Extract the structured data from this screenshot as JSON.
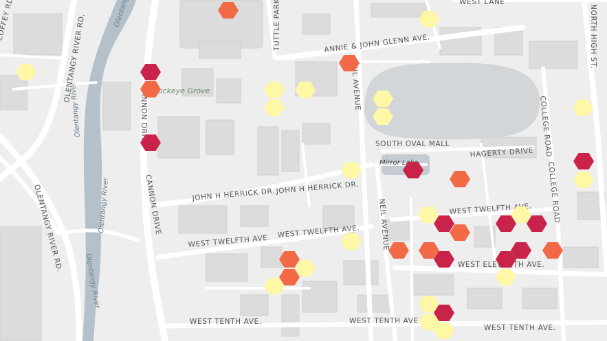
{
  "map": {
    "colors": {
      "low": "#fdf7a6",
      "medium": "#f26a45",
      "high": "#c9234a",
      "background": "#eeeeee",
      "road": "#ffffff",
      "building": "#dcdcdc",
      "water": "#b4c1cb",
      "oval": "#d3d6d8"
    },
    "labels": {
      "tuttle_park": "TUTTLE PARK",
      "west_lane": "WEST LANE",
      "high_street": "NORTH HIGH ST.",
      "olentangy_river_rd_top": "OLENTANGY RIVER RD.",
      "olentangy_top": "Olentangy",
      "olentangy_river_mid": "Olentangy River",
      "olentangy_river_mid2": "Olentangy River",
      "olentangy_river_bottom": "Olentangy River",
      "olentangy_river_rd_bottom": "OLENTANGY RIVER RD.",
      "coffey": "COFFEY RD",
      "annie_glenn": "ANNIE & JOHN GLENN AVE.",
      "neil_top": "NEIL AVENUE",
      "neil_bottom": "NEIL AVENUE",
      "buckeye_grove": "Buckeye Grove",
      "cannon_top": "CANNON DRIVE",
      "cannon_bottom": "CANNON DRIVE",
      "south_oval": "SOUTH OVAL MALL",
      "hagerty": "HAGERTY DRIVE",
      "mirror_lake": "Mirror Lake",
      "college_road_1": "COLLEGE ROAD",
      "college_road_2": "COLLEGE ROAD",
      "herrick_1": "JOHN H HERRICK DR.",
      "herrick_2": "JOHN H HERRICK DR.",
      "twelfth_1": "WEST TWELFTH AVE.",
      "twelfth_2": "WEST TWELFTH AVE.",
      "twelfth_3": "WEST TWELFTH AVE.",
      "eleventh": "WEST ELEVENTH AVE.",
      "tenth_1": "WEST TENTH AVE.",
      "tenth_2": "WEST TENTH AVE.",
      "tenth_3": "WEST TENTH AVE."
    },
    "hexbins": [
      {
        "level": "medium"
      },
      {
        "level": "low"
      },
      {
        "level": "low"
      },
      {
        "level": "high"
      },
      {
        "level": "medium"
      },
      {
        "level": "medium"
      },
      {
        "level": "high"
      },
      {
        "level": "low"
      },
      {
        "level": "low"
      },
      {
        "level": "low"
      },
      {
        "level": "low"
      },
      {
        "level": "low"
      },
      {
        "level": "low"
      },
      {
        "level": "low"
      },
      {
        "level": "high"
      },
      {
        "level": "low"
      },
      {
        "level": "high"
      },
      {
        "level": "medium"
      },
      {
        "level": "low"
      },
      {
        "level": "high"
      },
      {
        "level": "medium"
      },
      {
        "level": "high"
      },
      {
        "level": "low"
      },
      {
        "level": "high"
      },
      {
        "level": "low"
      },
      {
        "level": "medium"
      },
      {
        "level": "medium"
      },
      {
        "level": "high"
      },
      {
        "level": "high"
      },
      {
        "level": "high"
      },
      {
        "level": "medium"
      },
      {
        "level": "medium"
      },
      {
        "level": "low"
      },
      {
        "level": "medium"
      },
      {
        "level": "low"
      },
      {
        "level": "low"
      },
      {
        "level": "low"
      },
      {
        "level": "high"
      },
      {
        "level": "low"
      },
      {
        "level": "low"
      }
    ]
  }
}
